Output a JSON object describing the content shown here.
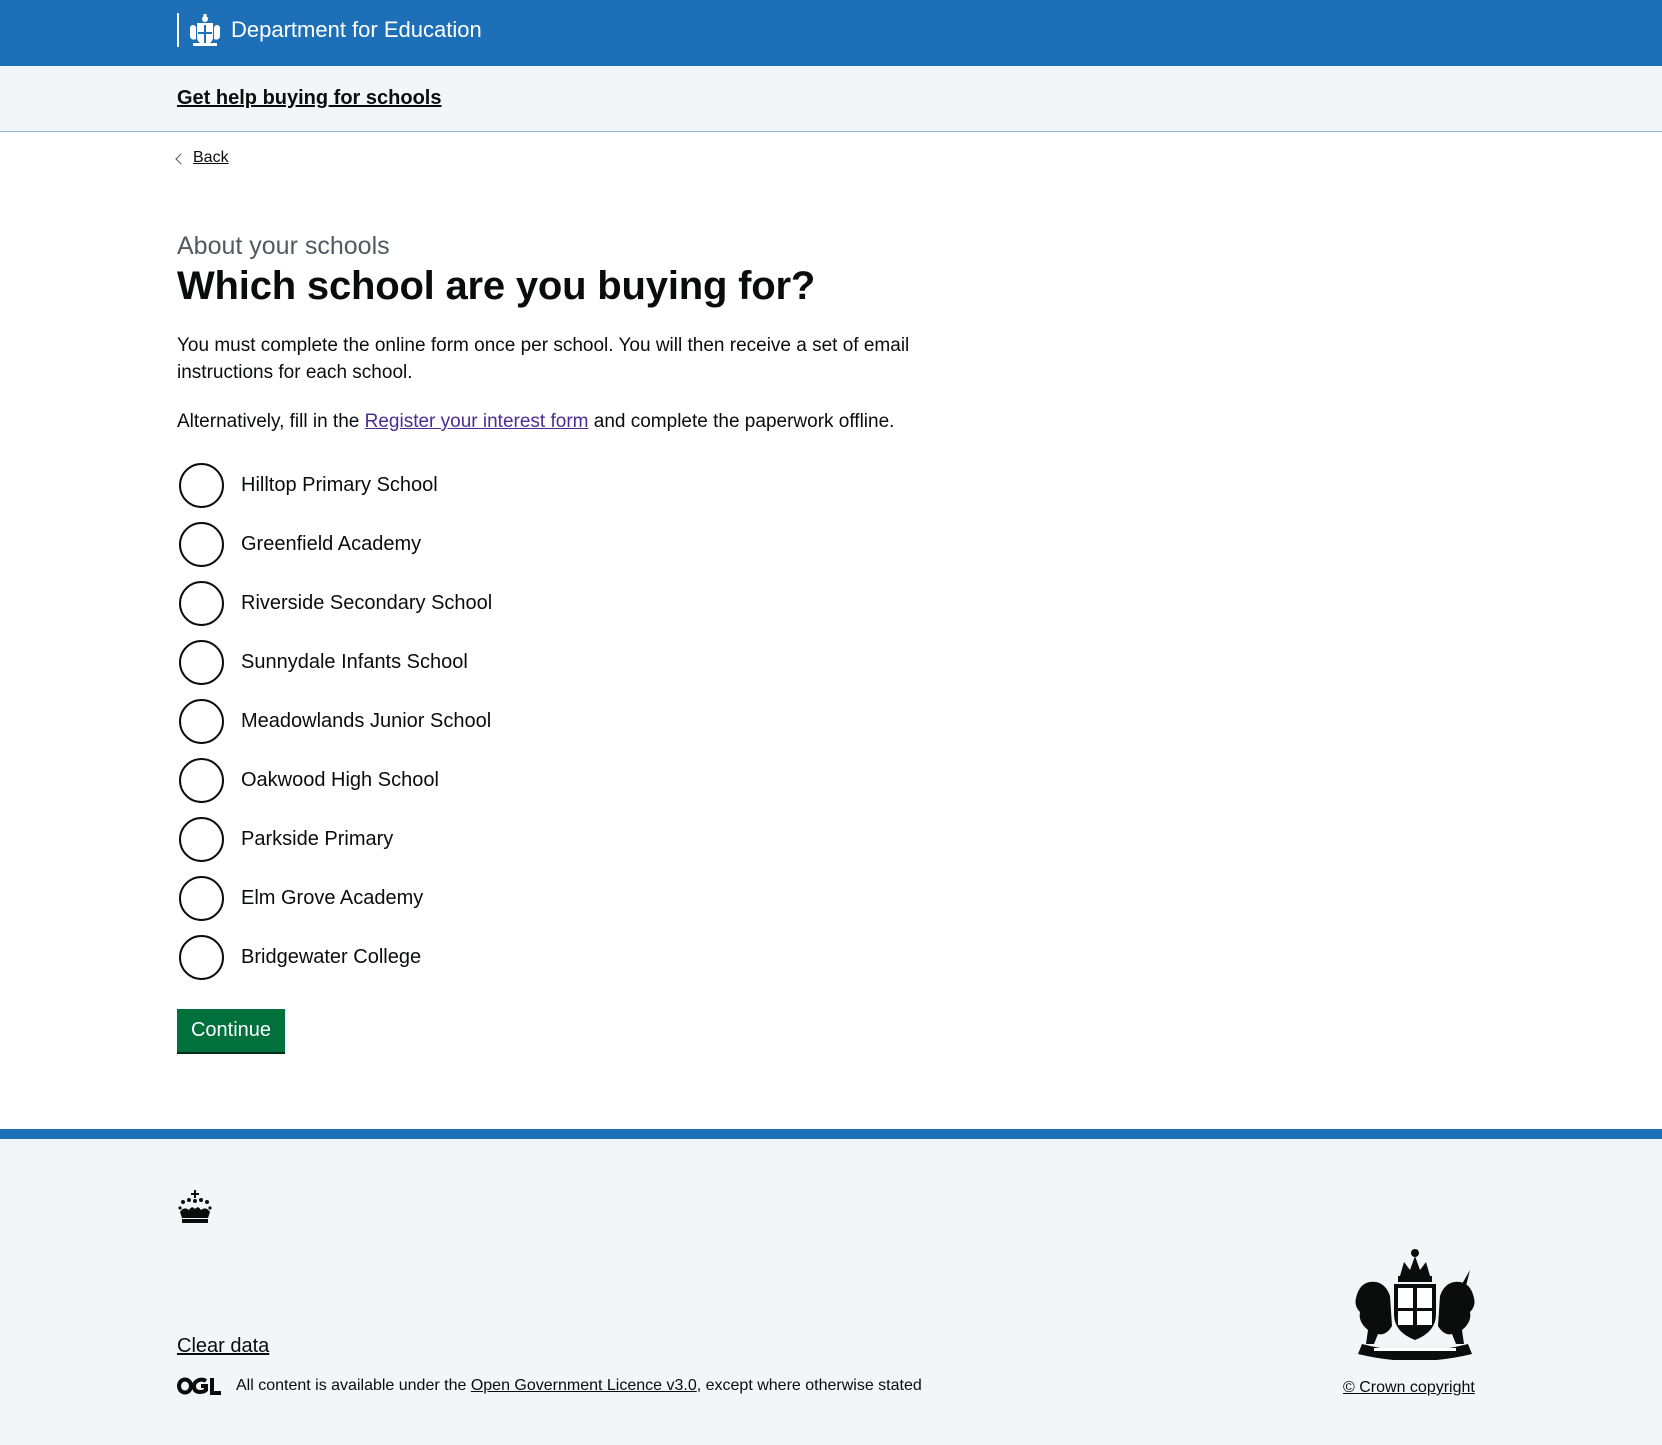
{
  "header": {
    "organisation": "Department for Education",
    "logo_icon": "royal-crest-icon"
  },
  "service": {
    "name": "Get help buying for schools"
  },
  "nav": {
    "back_label": "Back"
  },
  "form": {
    "caption": "About your schools",
    "heading": "Which school are you buying for?",
    "intro": "You must complete the online form once per school. You will then receive a set of email instructions for each school.",
    "alternative_prefix": "Alternatively, fill in the",
    "alternative_link": "Register your interest form",
    "alternative_suffix": "and complete the paperwork offline.",
    "options": [
      {
        "label": "Hilltop Primary School",
        "selected": false
      },
      {
        "label": "Greenfield Academy",
        "selected": false
      },
      {
        "label": "Riverside Secondary School",
        "selected": false
      },
      {
        "label": "Sunnydale Infants School",
        "selected": false
      },
      {
        "label": "Meadowlands Junior School",
        "selected": false
      },
      {
        "label": "Oakwood High School",
        "selected": false
      },
      {
        "label": "Parkside Primary",
        "selected": false
      },
      {
        "label": "Elm Grove Academy",
        "selected": false
      },
      {
        "label": "Bridgewater College",
        "selected": false
      }
    ],
    "continue_label": "Continue"
  },
  "footer": {
    "clear_data": "Clear data",
    "licence_prefix": "All content is available under the",
    "licence_link": "Open Government Licence v3.0",
    "licence_suffix": ", except where otherwise stated",
    "copyright": "© Crown copyright"
  },
  "colors": {
    "header_blue": "#1d70b8",
    "button_green": "#00703c",
    "link_purple": "#4c2c92",
    "footer_bg": "#f3f6f8"
  }
}
